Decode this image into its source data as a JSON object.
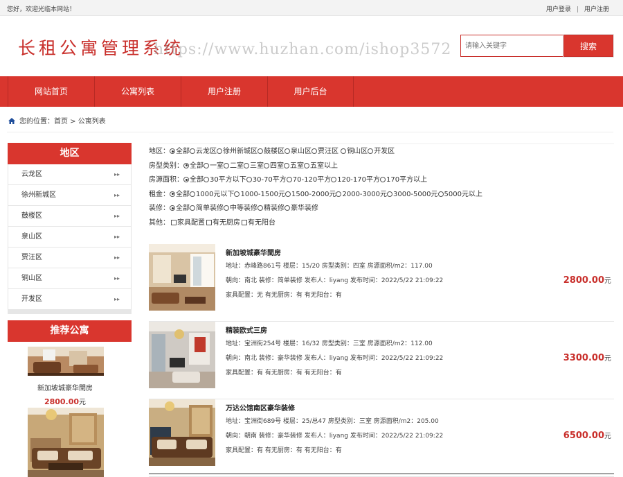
{
  "topbar": {
    "welcome": "您好，欢迎光临本网站！",
    "login": "用户登录",
    "separator": "|",
    "register": "用户注册"
  },
  "header": {
    "logo": "长租公寓管理系统",
    "watermark": "https://www.huzhan.com/ishop3572",
    "search_placeholder": "请输入关键字",
    "search_button": "搜索"
  },
  "nav": [
    "网站首页",
    "公寓列表",
    "用户注册",
    "用户后台"
  ],
  "breadcrumb": "您的位置：首页 > 公寓列表",
  "sidebar": {
    "area_title": "地区",
    "areas": [
      "云龙区",
      "徐州新城区",
      "鼓楼区",
      "泉山区",
      "贾汪区",
      "铜山区",
      "开发区"
    ],
    "arrow": "▸▸",
    "recommend_title": "推荐公寓",
    "recommended": [
      {
        "name": "新加坡城豪华閏房",
        "price": "2800.00",
        "unit": "元"
      }
    ]
  },
  "filters": [
    {
      "label": "地区：",
      "options": [
        "全部",
        "云龙区",
        "徐州新城区",
        "鼓楼区",
        "泉山区",
        "贾汪区",
        "铜山区",
        "开发区"
      ],
      "type": "radio"
    },
    {
      "label": "房型类别：",
      "options": [
        "全部",
        "一室",
        "二室",
        "三室",
        "四室",
        "五室",
        "五室以上"
      ],
      "type": "radio"
    },
    {
      "label": "房源面积：",
      "options": [
        "全部",
        "30平方以下",
        "30-70平方",
        "70-120平方",
        "120-170平方",
        "170平方以上"
      ],
      "type": "radio"
    },
    {
      "label": "租金：",
      "options": [
        "全部",
        "1000元以下",
        "1000-1500元",
        "1500-2000元",
        "2000-3000元",
        "3000-5000元",
        "5000元以上"
      ],
      "type": "radio"
    },
    {
      "label": "装修：",
      "options": [
        "全部",
        "简单装修",
        "中等装修",
        "精装修",
        "豪华装修"
      ],
      "type": "radio"
    },
    {
      "label": "其他：",
      "options": [
        "家具配置",
        "有无厨房",
        "有无阳台"
      ],
      "type": "checkbox"
    }
  ],
  "listings": [
    {
      "title": "新加坡城豪华閏房",
      "line1": "地址：赤峰路861号   楼层：15/20   房型类别：四室   房源面积/m2：117.00",
      "line2": "朝向：南北   装修：简单装修   发布人：liyang   发布时间：2022/5/22 21:09:22",
      "line3": "家具配置：无   有无厨房：有   有无阳台：有",
      "price": "2800.00",
      "unit": "元"
    },
    {
      "title": "精装欧式三房",
      "line1": "地址：宝洲街254号   楼层：16/32   房型类别：三室   房源面积/m2：112.00",
      "line2": "朝向：南北   装修：豪华装修   发布人：liyang   发布时间：2022/5/22 21:09:22",
      "line3": "家具配置：有   有无厨房：有   有无阳台：有",
      "price": "3300.00",
      "unit": "元"
    },
    {
      "title": "万达公馆南区豪华装修",
      "line1": "地址：宝洲街689号   楼层：25/总47   房型类别：三室   房源面积/m2：205.00",
      "line2": "朝向：朝南   装修：豪华装修   发布人：liyang   发布时间：2022/5/22 21:09:22",
      "line3": "家具配置：有   有无厨房：有   有无阳台：有",
      "price": "6500.00",
      "unit": "元"
    }
  ],
  "colors": {
    "brand_red": "#d9362e",
    "price_red": "#c9302c"
  }
}
